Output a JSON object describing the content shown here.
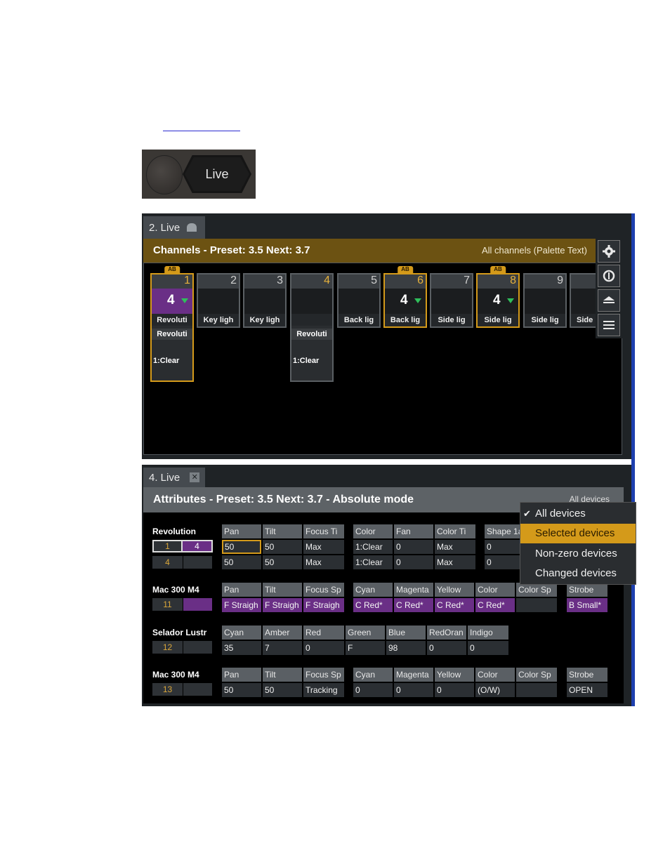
{
  "live_button": {
    "label": "Live"
  },
  "panel1": {
    "tab_label": "2. Live",
    "header_title": "Channels - Preset: 3.5   Next: 3.7",
    "header_right": "All channels (Palette Text)",
    "channels": [
      {
        "num": "1",
        "level": "4",
        "label": "Revoluti",
        "badge": "AB",
        "ext_a": "Revoluti",
        "ext_b": "1:Clear"
      },
      {
        "num": "2",
        "level": "",
        "label": "Key ligh",
        "badge": ""
      },
      {
        "num": "3",
        "level": "",
        "label": "Key ligh",
        "badge": ""
      },
      {
        "num": "4",
        "level": "",
        "label": "",
        "badge": "",
        "ext_a": "Revoluti",
        "ext_b": "1:Clear"
      },
      {
        "num": "5",
        "level": "",
        "label": "Back lig",
        "badge": ""
      },
      {
        "num": "6",
        "level": "4",
        "label": "Back lig",
        "badge": "AB"
      },
      {
        "num": "7",
        "level": "",
        "label": "Side lig",
        "badge": ""
      },
      {
        "num": "8",
        "level": "4",
        "label": "Side lig",
        "badge": "AB"
      },
      {
        "num": "9",
        "level": "",
        "label": "Side lig",
        "badge": ""
      },
      {
        "num": "",
        "level": "",
        "label": "Side",
        "badge": ""
      }
    ],
    "side_buttons": [
      "gear-icon",
      "sync-icon",
      "page-up-icon",
      "page-down-icon"
    ]
  },
  "panel2": {
    "tab_label": "4. Live",
    "header_title": "Attributes - Preset: 3.5 Next: 3.7 - Absolute mode",
    "header_right": "All devices",
    "fixtures": [
      {
        "name": "Revolution",
        "ids": [
          [
            "1",
            "4"
          ],
          [
            "4",
            ""
          ]
        ],
        "groups": [
          {
            "headers": [
              "Pan",
              "Tilt",
              "Focus Ti"
            ],
            "rows": [
              [
                "50",
                "50",
                "Max"
              ],
              [
                "50",
                "50",
                "Max"
              ]
            ]
          },
          {
            "headers": [
              "Color",
              "Fan",
              "Color Ti"
            ],
            "rows": [
              [
                "1:Clear",
                "0",
                "Max"
              ],
              [
                "1:Clear",
                "0",
                "Max"
              ]
            ]
          },
          {
            "headers": [
              "Shape 1a"
            ],
            "rows": [
              [
                "0"
              ],
              [
                "0"
              ]
            ]
          }
        ]
      },
      {
        "name": "Mac 300 M4",
        "ids": [
          [
            "11",
            ""
          ]
        ],
        "groups": [
          {
            "headers": [
              "Pan",
              "Tilt",
              "Focus Sp"
            ],
            "rows": [
              [
                "F Straigh",
                "F Straigh",
                "F Straigh"
              ]
            ]
          },
          {
            "headers": [
              "Cyan",
              "Magenta",
              "Yellow",
              "Color",
              "Color Sp"
            ],
            "rows": [
              [
                "C Red*",
                "C Red*",
                "C Red*",
                "C Red*",
                ""
              ]
            ]
          },
          {
            "headers": [
              "Strobe"
            ],
            "rows": [
              [
                "B Small*"
              ]
            ]
          }
        ]
      },
      {
        "name": "Selador Lustr",
        "ids": [
          [
            "12",
            ""
          ]
        ],
        "groups": [
          {
            "headers": [
              "Cyan",
              "Amber",
              "Red",
              "Green",
              "Blue",
              "RedOran",
              "Indigo"
            ],
            "rows": [
              [
                "35",
                "7",
                "0",
                "F",
                "98",
                "0",
                "0"
              ]
            ]
          }
        ]
      },
      {
        "name": "Mac 300 M4",
        "ids": [
          [
            "13",
            ""
          ]
        ],
        "groups": [
          {
            "headers": [
              "Pan",
              "Tilt",
              "Focus Sp"
            ],
            "rows": [
              [
                "50",
                "50",
                "Tracking"
              ]
            ]
          },
          {
            "headers": [
              "Cyan",
              "Magenta",
              "Yellow",
              "Color",
              "Color Sp"
            ],
            "rows": [
              [
                "0",
                "0",
                "0",
                "(O/W)",
                ""
              ]
            ]
          },
          {
            "headers": [
              "Strobe"
            ],
            "rows": [
              [
                "OPEN"
              ]
            ]
          }
        ]
      }
    ],
    "menu": [
      {
        "label": "All devices",
        "checked": "✔"
      },
      {
        "label": "Selected devices"
      },
      {
        "label": "Non-zero devices"
      },
      {
        "label": "Changed devices"
      }
    ]
  },
  "colors": {
    "accent": "#d49a1a",
    "header_gold": "#6c5212",
    "purple": "#6a2f86",
    "blue_edge": "#1d3fae"
  }
}
